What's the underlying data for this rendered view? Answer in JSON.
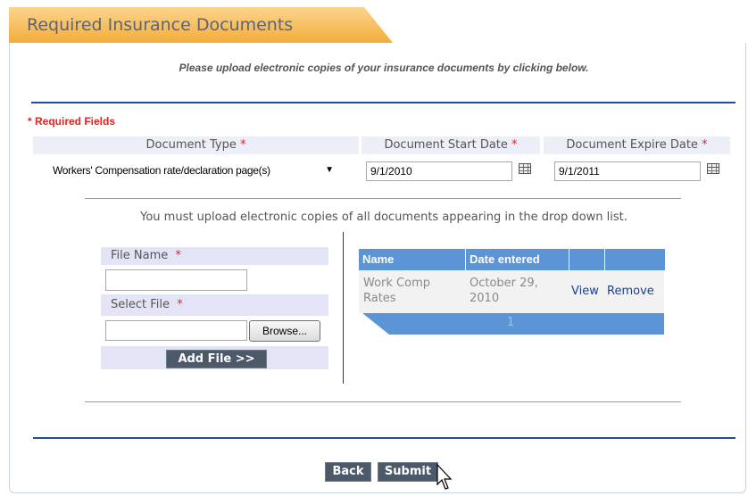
{
  "title": "Required Insurance Documents",
  "instructions": "Please upload electronic copies of your insurance documents by clicking below.",
  "required_note": "* Required Fields",
  "headers": {
    "document_type": "Document Type",
    "start_date": "Document Start Date",
    "expire_date": "Document Expire Date",
    "required_mark": "*"
  },
  "document_type_value": "Workers' Compensation rate/declaration page(s)",
  "start_date_value": "9/1/2010",
  "expire_date_value": "9/1/2011",
  "upload_note": "You must upload electronic copies of all documents appearing in the drop down list.",
  "form": {
    "file_name_label": "File Name",
    "file_name_value": "",
    "select_file_label": "Select File",
    "select_file_value": "",
    "browse_label": "Browse...",
    "add_file_label": "Add File >>"
  },
  "grid": {
    "columns": [
      "Name",
      "Date entered",
      "",
      ""
    ],
    "rows": [
      {
        "name_line1": "Work Comp",
        "name_line2": "Rates",
        "date_line1": "October 29,",
        "date_line2": "2010",
        "view": "View",
        "remove": "Remove"
      }
    ],
    "page": "1"
  },
  "buttons": {
    "back": "Back",
    "submit": "Submit"
  },
  "colors": {
    "tab_orange": "#f4ad3b",
    "grid_blue": "#5b95d5",
    "divider_blue": "#1f4e9c",
    "required_red": "#e8201f",
    "button_dark": "#4b5968"
  },
  "icons": [
    "calendar-icon",
    "dropdown-arrow-icon",
    "cursor-icon"
  ]
}
